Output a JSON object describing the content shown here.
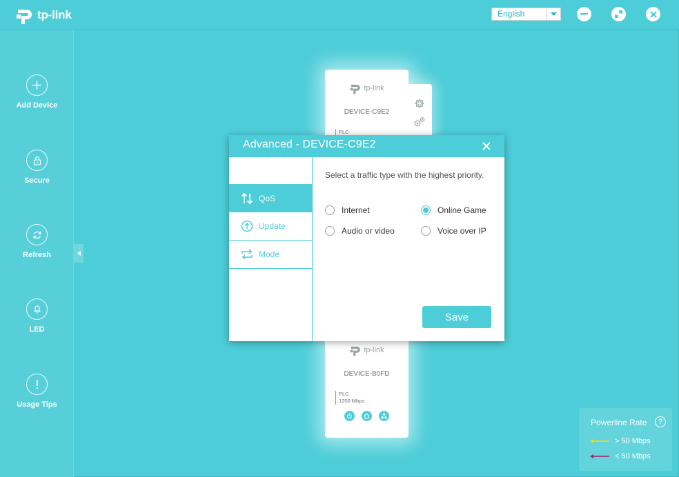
{
  "app": {
    "brand": "tp-link"
  },
  "language": {
    "selected": "English"
  },
  "sidebar": {
    "items": [
      {
        "label": "Add Device",
        "icon": "plus-icon"
      },
      {
        "label": "Secure",
        "icon": "lock-icon"
      },
      {
        "label": "Refresh",
        "icon": "refresh-icon"
      },
      {
        "label": "LED",
        "icon": "bulb-icon"
      },
      {
        "label": "Usage Tips",
        "icon": "exclamation-icon"
      }
    ]
  },
  "devices": [
    {
      "brand": "tp-link",
      "name": "DEVICE-C9E2",
      "plc_label": "PLC"
    },
    {
      "brand": "tp-link",
      "name": "DEVICE-B0FD",
      "plc_label": "PLC",
      "plc_rate": "1200 Mbps"
    }
  ],
  "modal": {
    "title": "Advanced - DEVICE-C9E2",
    "menu": [
      {
        "label": "QoS",
        "icon": "qos-arrows-icon",
        "active": true
      },
      {
        "label": "Update",
        "icon": "update-arrow-icon",
        "active": false
      },
      {
        "label": "Mode",
        "icon": "mode-loop-icon",
        "active": false
      }
    ],
    "prompt": "Select a traffic type with the highest priority.",
    "options": [
      {
        "label": "Internet",
        "checked": false
      },
      {
        "label": "Online Game",
        "checked": true
      },
      {
        "label": "Audio or video",
        "checked": false
      },
      {
        "label": "Voice over IP",
        "checked": false
      }
    ],
    "save_label": "Save"
  },
  "powerline_rate": {
    "title": "Powerline Rate",
    "help": "?",
    "legend": [
      {
        "label": "> 50 Mbps",
        "color": "#f5e100"
      },
      {
        "label": "< 50 Mbps",
        "color": "#b0186c"
      }
    ]
  }
}
